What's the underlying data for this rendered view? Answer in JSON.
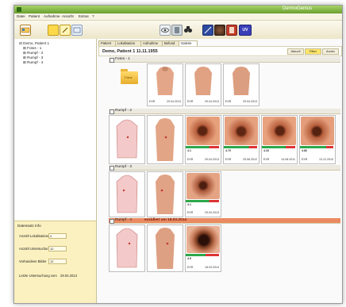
{
  "window": {
    "title": "DermoGenius"
  },
  "menu": [
    "Datei",
    "Patient",
    "Aufnahme",
    "Ansicht",
    "Extras",
    "?"
  ],
  "toolbar": {
    "icons": [
      "patient-card-icon",
      "notes-icon",
      "edit-icon",
      "image-icon",
      "camera-eye-icon",
      "dermatoscope-icon",
      "binoculars-icon",
      "compare-icon",
      "body-map-icon",
      "report-icon",
      "uv-icon"
    ],
    "uv_label": "UV"
  },
  "tree": {
    "root": "Demo, Patient 1",
    "children": [
      "Fotos - 1",
      "Rumpf - 2",
      "Rumpf - 3",
      "Rumpf - 4"
    ]
  },
  "tabs": [
    "Patient",
    "Lokalisation",
    "Aufnahme",
    "Befund",
    "Galerie"
  ],
  "active_tab": "Galerie",
  "patient_header": {
    "name": "Demo, Patient 1   11.11.1955",
    "view_buttons": [
      "Aktuell",
      "Filter",
      "Archiv"
    ],
    "active_view": "Filter"
  },
  "sections": [
    {
      "label": "Fotos - 1",
      "excised": ""
    },
    {
      "label": "Rumpf - 2",
      "excised": ""
    },
    {
      "label": "Rumpf - 3",
      "excised": ""
    },
    {
      "label": "Rumpf - 4",
      "excised": "exzidiert am 18.03.2014"
    }
  ],
  "folder_label": "Fotos",
  "fotos_thumbs": [
    {
      "source": "EXR",
      "date": "29.04.2013"
    },
    {
      "source": "EXR",
      "date": "29.04.2013"
    },
    {
      "source": "EXR",
      "date": "29.04.2013"
    }
  ],
  "rumpf2_thumbs": [
    {
      "score": "4.1",
      "source": "EXR",
      "date": "29.04.2013"
    },
    {
      "score": "4.70",
      "source": "EXR",
      "date": "29.06.2012"
    },
    {
      "score": "4.33",
      "source": "EXR",
      "date": "14.08.2011"
    },
    {
      "score": "4.86",
      "source": "EXR",
      "date": "13.12.2010"
    }
  ],
  "rumpf3_thumbs": [
    {
      "score": "4.1",
      "source": "EXR",
      "date": "29.04.2013"
    }
  ],
  "rumpf4_thumbs": [
    {
      "score": "4.5",
      "source": "EXR",
      "date": "18.03.2014"
    }
  ],
  "info_panel": {
    "header": "Datensatz Info",
    "rows": [
      {
        "label": "Anzahl Lokalisationen",
        "value": "4"
      },
      {
        "label": "Anzahl Untersuchungen",
        "value": "12"
      },
      {
        "label": "Vorhandene Bilder",
        "value": "12"
      }
    ],
    "last_exam_label": "Letzte Untersuchung vom",
    "last_exam_date": "29.04.2013"
  },
  "colors": {
    "titlebar": "#7fb33f",
    "info_panel": "#fbf1c0",
    "excised_bar": "#eb8a62",
    "active_filter": "#ffe56b"
  }
}
